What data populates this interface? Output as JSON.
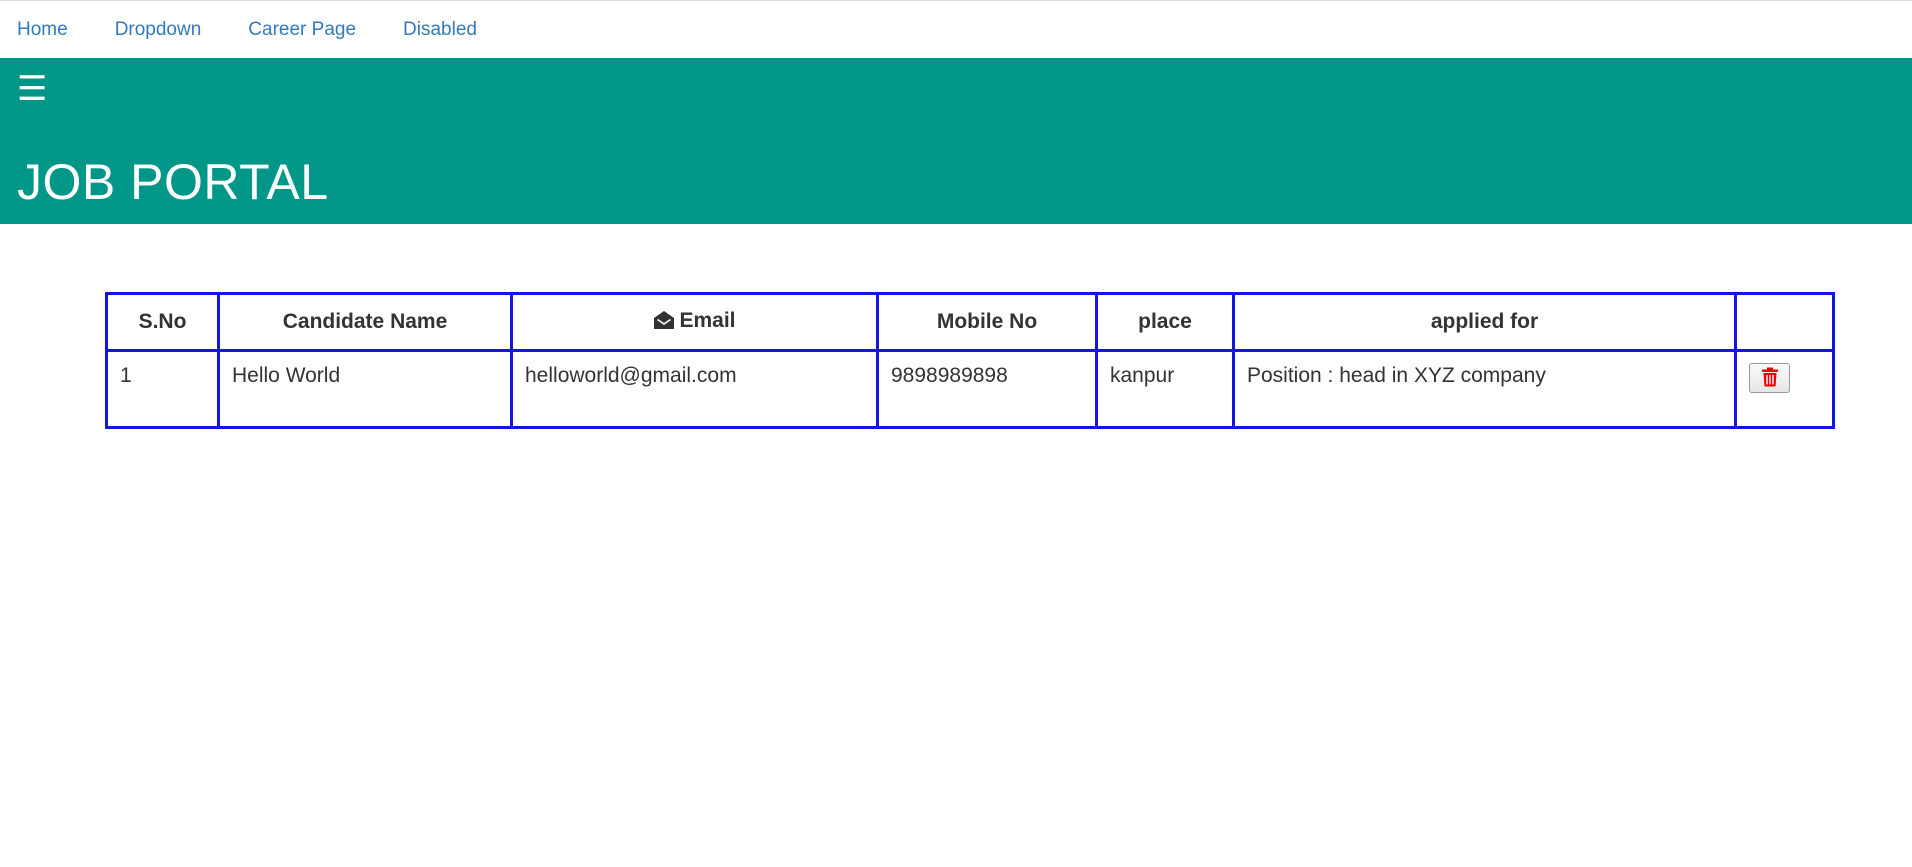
{
  "nav": {
    "items": [
      {
        "label": "Home"
      },
      {
        "label": "Dropdown"
      },
      {
        "label": "Career Page"
      },
      {
        "label": "Disabled"
      }
    ]
  },
  "banner": {
    "menu_icon": "hamburger-icon",
    "menu_glyph": "☰",
    "title": "JOB PORTAL",
    "background": "#009688"
  },
  "table": {
    "border_color": "#1414e6",
    "headers": [
      "S.No",
      "Candidate Name",
      "Email",
      "Mobile No",
      "place",
      "applied for",
      ""
    ],
    "email_header_icon": "envelope-open-icon",
    "rows": [
      {
        "sno": "1",
        "name": "Hello World",
        "email": "helloworld@gmail.com",
        "mobile": "9898989898",
        "place": "kanpur",
        "applied_for": "Position : head in XYZ company",
        "action_icon": "trash-icon",
        "action_color": "#ee0000"
      }
    ]
  }
}
